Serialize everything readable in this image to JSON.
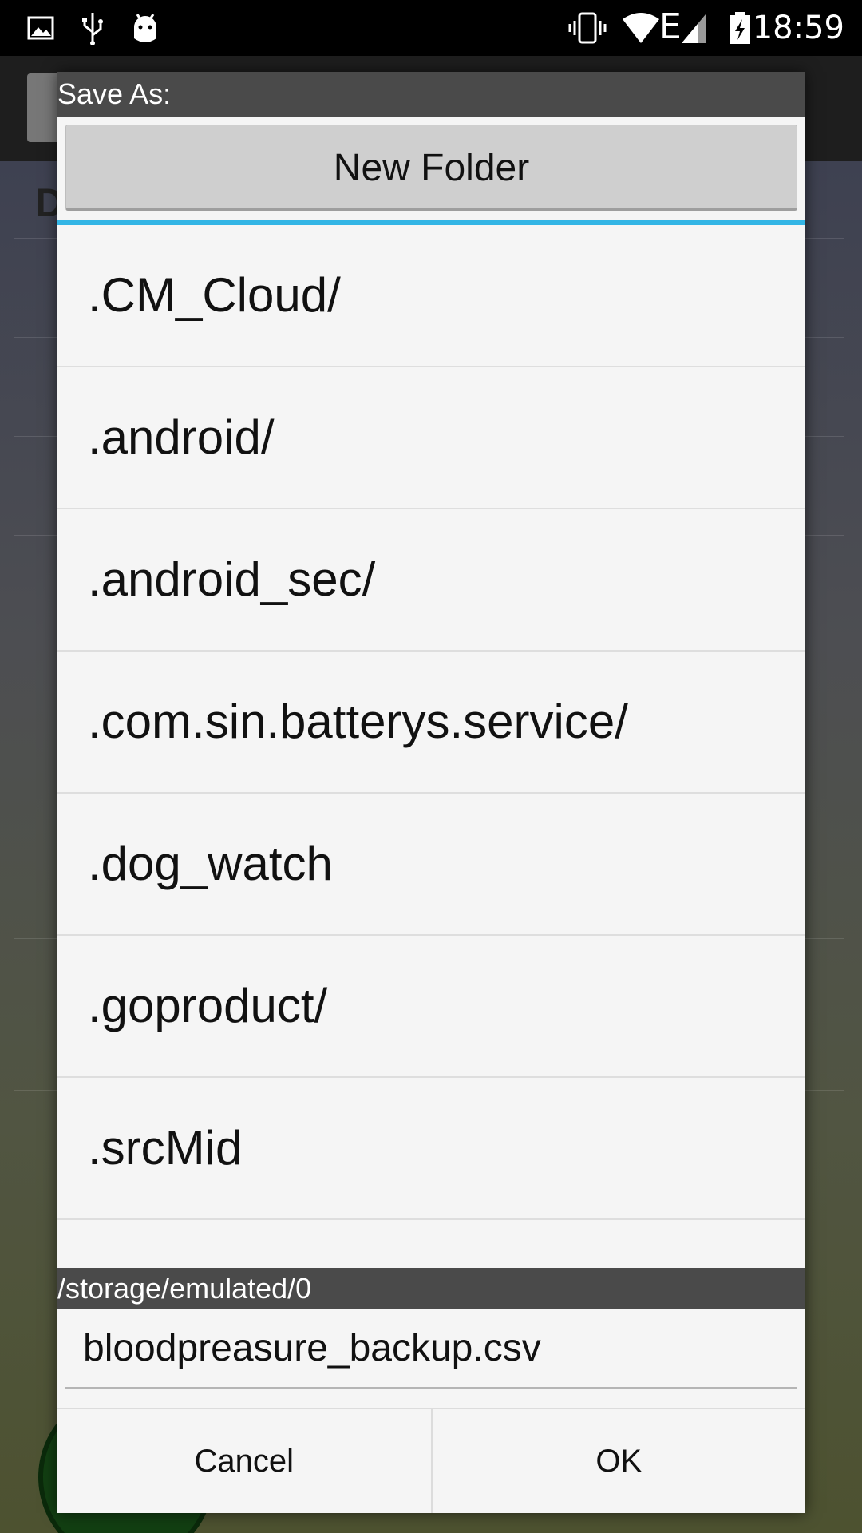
{
  "status_bar": {
    "time": "18:59",
    "left_icons": [
      "image-icon",
      "usb-icon",
      "android-debug-icon"
    ],
    "right_icons": [
      "vibrate-icon",
      "wifi-icon",
      "signal-edge-icon",
      "battery-charging-icon"
    ],
    "network_type": "E"
  },
  "dialog": {
    "title": "Save As:",
    "new_folder_label": "New Folder",
    "folders": [
      ".CM_Cloud/",
      ".android/",
      ".android_sec/",
      ".com.sin.batterys.service/",
      ".dog_watch",
      ".goproduct/",
      ".srcMid"
    ],
    "current_path": "/storage/emulated/0",
    "filename_value": "bloodpreasure_backup.csv",
    "cancel_label": "Cancel",
    "ok_label": "OK",
    "accent_color": "#33b5e5"
  }
}
